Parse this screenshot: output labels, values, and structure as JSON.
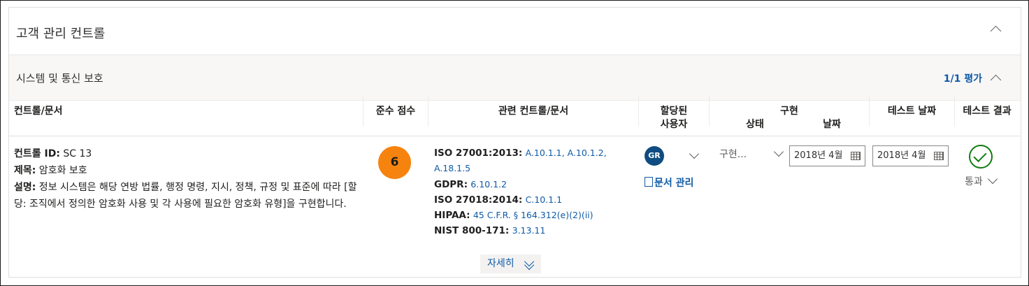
{
  "header": {
    "title": "고객 관리 컨트롤"
  },
  "section": {
    "label": "시스템 및 통신 보호",
    "assessment": "1/1 평가"
  },
  "columns": {
    "control": "컨트롤/문서",
    "score": "준수 점수",
    "related": "관련 컨트롤/문서",
    "assigned_line1": "할당된",
    "assigned_line2": "사용자",
    "impl": "구현",
    "impl_status": "상태",
    "impl_date": "날짜",
    "test_date": "테스트 날짜",
    "test_result": "테스트 결과"
  },
  "row": {
    "control_id_label": "컨트롤 ID:",
    "control_id": " SC 13",
    "title_label": "제목:",
    "title": " 암호화 보호",
    "desc_label": "설명:",
    "desc": " 정보 시스템은 해당 연방 법률, 행정 명령, 지시, 정책, 규정 및 표준에 따라 [할당: 조직에서 정의한 암호화 사용 및 각 사용에 필요한 암호화 유형]을 구현합니다.",
    "score": "6",
    "related": [
      {
        "key": "ISO 27001:2013:",
        "value": "A.10.1.1, A.10.1.2, A.18.1.5"
      },
      {
        "key": "GDPR:",
        "value": "6.10.1.2"
      },
      {
        "key": "ISO 27018:2014:",
        "value": "C.10.1.1"
      },
      {
        "key": "HIPAA:",
        "value": "45 C.F.R. § 164.312(e)(2)(ii)"
      },
      {
        "key": "NIST 800-171:",
        "value": "3.13.11"
      }
    ],
    "assignee_initials": "GR",
    "doc_manage": "문서 관리",
    "impl_status": "구현...",
    "impl_date": "2018년 4월",
    "test_date": "2018년 4월",
    "test_result": "통과"
  },
  "more_button": "자세히",
  "colors": {
    "accent": "#0f5aa6",
    "score": "#f7830f",
    "pass": "#107c10",
    "avatar": "#0f4c81"
  }
}
